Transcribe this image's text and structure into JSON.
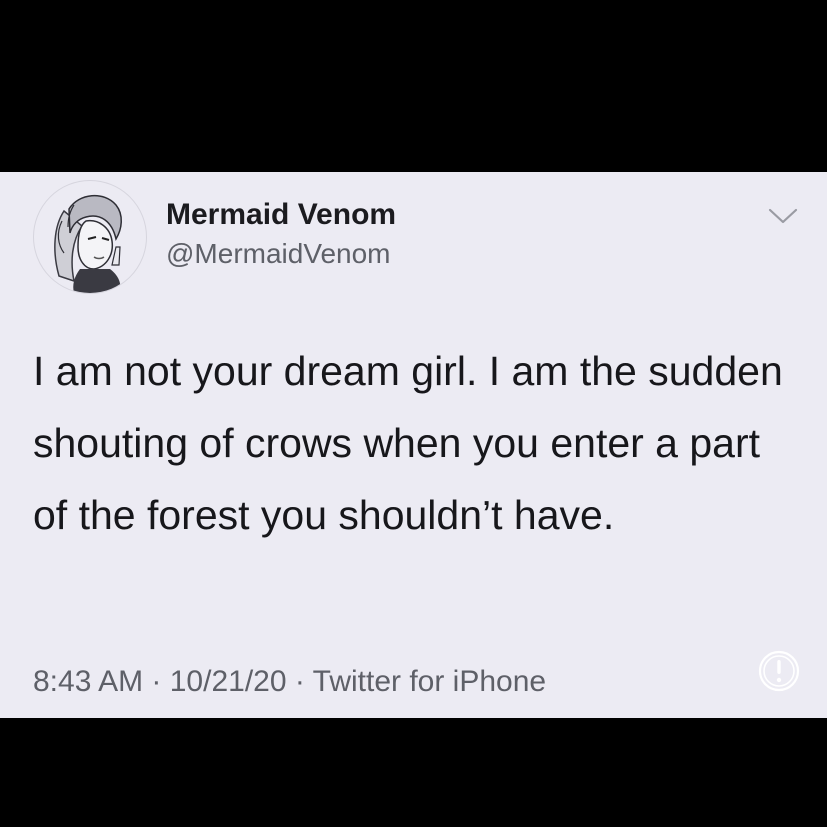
{
  "tweet": {
    "display_name": "Mermaid Venom",
    "handle": "@MermaidVenom",
    "text": "I am not your dream girl. I am the sudden shouting of crows when you enter a part of the forest you shouldn’t have.",
    "time": "8:43 AM",
    "date": "10/21/20",
    "source": "Twitter for iPhone",
    "separator": " · "
  },
  "icons": {
    "avatar": "avatar-illustration",
    "menu": "chevron-down-icon",
    "info": "info-icon"
  },
  "colors": {
    "card_background": "#ecebf3",
    "frame_background": "#000000",
    "primary_text": "#17171b",
    "secondary_text": "#5e6068"
  }
}
